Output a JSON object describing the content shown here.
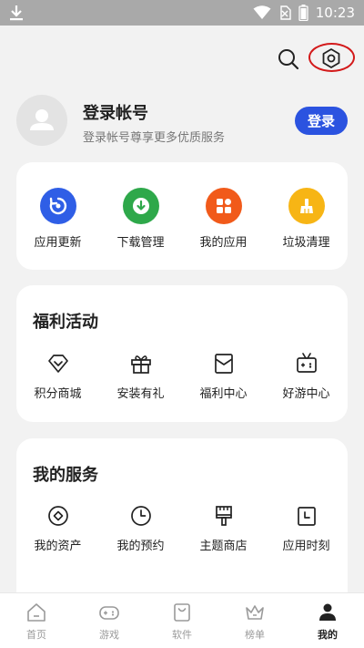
{
  "status_bar": {
    "time": "10:23"
  },
  "profile": {
    "title": "登录帐号",
    "subtitle": "登录帐号尊享更多优质服务",
    "login_button": "登录"
  },
  "quick_actions": [
    {
      "label": "应用更新",
      "icon": "refresh-icon",
      "color": "#2f5ee6"
    },
    {
      "label": "下载管理",
      "icon": "download-icon",
      "color": "#2ea84a"
    },
    {
      "label": "我的应用",
      "icon": "apps-grid-icon",
      "color": "#f15a1a"
    },
    {
      "label": "垃圾清理",
      "icon": "broom-icon",
      "color": "#f7b515"
    }
  ],
  "benefits": {
    "title": "福利活动",
    "items": [
      {
        "label": "积分商城",
        "icon": "diamond-icon"
      },
      {
        "label": "安装有礼",
        "icon": "gift-icon"
      },
      {
        "label": "福利中心",
        "icon": "envelope-icon"
      },
      {
        "label": "好游中心",
        "icon": "game-tv-icon"
      }
    ]
  },
  "services": {
    "title": "我的服务",
    "items": [
      {
        "label": "我的资产",
        "icon": "coin-icon"
      },
      {
        "label": "我的预约",
        "icon": "clock-icon"
      },
      {
        "label": "主题商店",
        "icon": "brush-icon"
      },
      {
        "label": "应用时刻",
        "icon": "calendar-icon"
      }
    ]
  },
  "bottom_nav": [
    {
      "label": "首页",
      "icon": "home-icon",
      "active": false
    },
    {
      "label": "游戏",
      "icon": "gamepad-icon",
      "active": false
    },
    {
      "label": "软件",
      "icon": "bag-icon",
      "active": false
    },
    {
      "label": "榜单",
      "icon": "crown-icon",
      "active": false
    },
    {
      "label": "我的",
      "icon": "person-icon",
      "active": true
    }
  ]
}
